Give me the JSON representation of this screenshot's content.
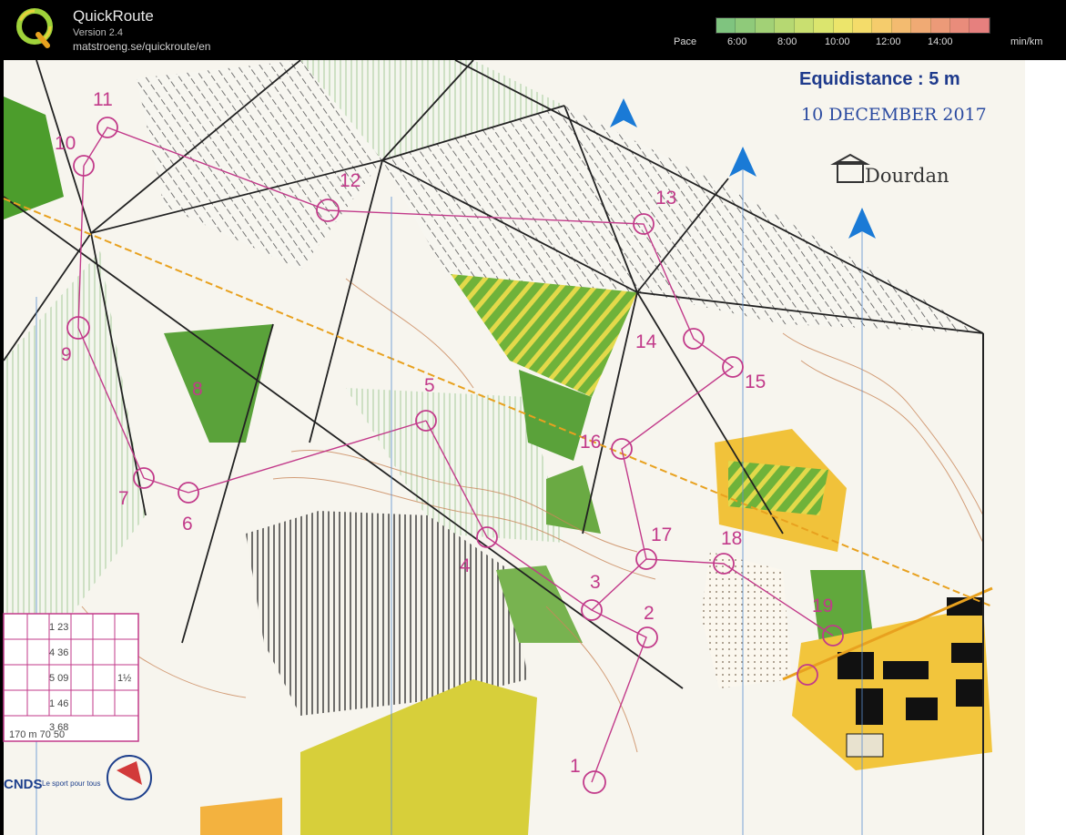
{
  "app": {
    "title": "QuickRoute",
    "version": "Version 2.4",
    "url": "matstroeng.se/quickroute/en",
    "logo_letter": "Q"
  },
  "pace_scale": {
    "label": "Pace",
    "ticks": [
      "6:00",
      "8:00",
      "10:00",
      "12:00",
      "14:00"
    ],
    "unit": "min/km",
    "colors": [
      "#7fc47f",
      "#8fca7a",
      "#a2d176",
      "#b6d872",
      "#c9df70",
      "#dbe56e",
      "#ece56b",
      "#f4dc6a",
      "#f5cc6c",
      "#f3bb70",
      "#f0aa74",
      "#ec9a78",
      "#e98c7b",
      "#e6807e"
    ]
  },
  "map": {
    "equidistance": "Equidistance : 5 m",
    "date_note": "10 DECEMBER 2017",
    "brand": "Dourdan",
    "logo_text": "CNDS",
    "logo_sub": "Le sport pour tous",
    "controls": [
      {
        "label": "1"
      },
      {
        "label": "2"
      },
      {
        "label": "3"
      },
      {
        "label": "4"
      },
      {
        "label": "5"
      },
      {
        "label": "6"
      },
      {
        "label": "7"
      },
      {
        "label": "8"
      },
      {
        "label": "9"
      },
      {
        "label": "10"
      },
      {
        "label": "11"
      },
      {
        "label": "12"
      },
      {
        "label": "13"
      },
      {
        "label": "14"
      },
      {
        "label": "15"
      },
      {
        "label": "16"
      },
      {
        "label": "17"
      },
      {
        "label": "18"
      },
      {
        "label": "19"
      }
    ],
    "legend_table": {
      "rows": [
        "1 23",
        "4 36",
        "5 09",
        "1 46",
        "3 68"
      ],
      "side_note": "1½",
      "footer": "170 m  70 50"
    }
  }
}
